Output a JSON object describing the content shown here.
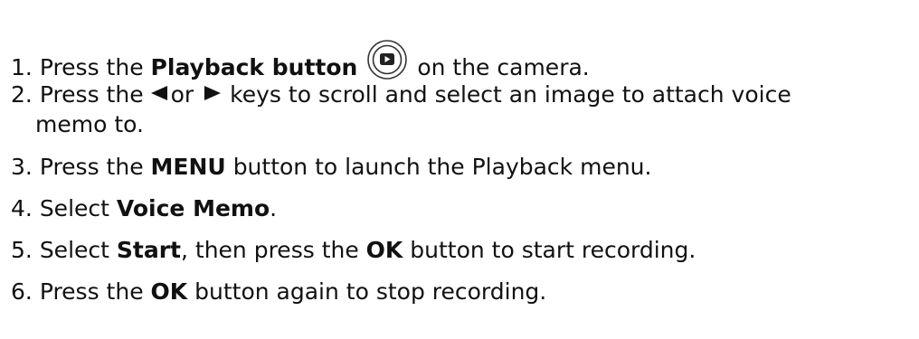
{
  "steps": [
    {
      "num": "1.",
      "pre": "Press the",
      "bold": "Playback button",
      "icon": "playback-button-icon",
      "post": "on the camera."
    },
    {
      "num": "2.",
      "pre": "Press the",
      "left_icon": "left-arrow-key-icon",
      "mid": "or",
      "right_icon": "right-arrow-key-icon",
      "post": "keys to scroll and select an image to attach voice",
      "cont": "memo to."
    },
    {
      "num": "3.",
      "pre": "Press the",
      "bold": "MENU",
      "post": "button to launch the Playback menu."
    },
    {
      "num": "4.",
      "pre": "Select",
      "bold": "Voice Memo",
      "post": "."
    },
    {
      "num": "5.",
      "pre": "Select",
      "bold": "Start",
      "mid": ", then press the",
      "bold2": "OK",
      "post": "button to start recording."
    },
    {
      "num": "6.",
      "pre": "Press the",
      "bold": "OK",
      "post": "button again to stop recording."
    }
  ]
}
